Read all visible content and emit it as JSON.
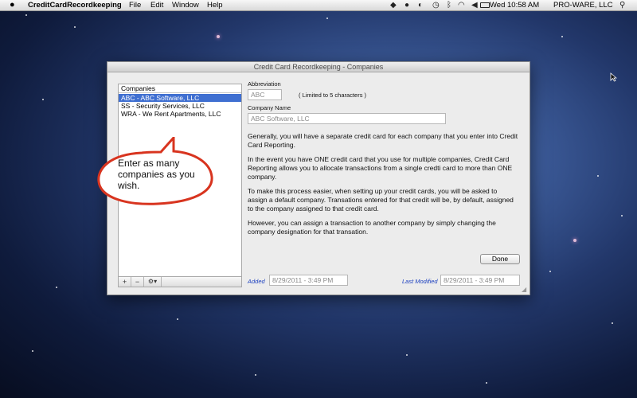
{
  "menubar": {
    "app_name": "CreditCardRecordkeeping",
    "menus": [
      "File",
      "Edit",
      "Window",
      "Help"
    ],
    "clock": "Wed 10:58 AM",
    "user": "PRO-WARE, LLC",
    "status_icons": [
      "dropbox-icon",
      "record-icon",
      "headset-icon",
      "time-machine-icon",
      "bluetooth-icon",
      "wifi-icon",
      "volume-icon",
      "battery-icon"
    ]
  },
  "window": {
    "title": "Credit Card Recordkeeping - Companies"
  },
  "companies": {
    "header": "Companies",
    "items": [
      {
        "label": "ABC - ABC Software, LLC",
        "selected": true
      },
      {
        "label": "SS - Security Services, LLC",
        "selected": false
      },
      {
        "label": "WRA - We Rent Apartments, LLC",
        "selected": false
      }
    ],
    "add_label": "+",
    "remove_label": "−",
    "gear_label": "⚙▾"
  },
  "form": {
    "abbreviation_label": "Abbreviation",
    "abbreviation_value": "ABC",
    "abbreviation_hint": "( Limited to 5 characters )",
    "company_name_label": "Company Name",
    "company_name_value": "ABC Software, LLC"
  },
  "description": {
    "p1": "Generally, you will have a separate credit card for each company that you enter into Credit Card Reporting.",
    "p2": "In the event you have ONE credit card that you use for multiple companies, Credit Card Reporting allows you to allocate transactions from a single credti card to more than ONE company.",
    "p3": "To make this process easier, when setting up your credit cards, you will be asked to assign a default company.  Transations entered for that credit will be, by default, assigned to the company assigned to that credit card.",
    "p4": "However, you can assign a transaction to another company by simply changing the company designation for that transation."
  },
  "done_label": "Done",
  "footer": {
    "added_label": "Added",
    "added_value": "8/29/2011 - 3:49 PM",
    "modified_label": "Last Modified",
    "modified_value": "8/29/2011 - 3:49 PM"
  },
  "callout": {
    "text": "Enter as many companies as you wish."
  },
  "colors": {
    "selection": "#3f6fd1",
    "callout_border": "#d8341f",
    "link_blue": "#1b3fbf"
  }
}
